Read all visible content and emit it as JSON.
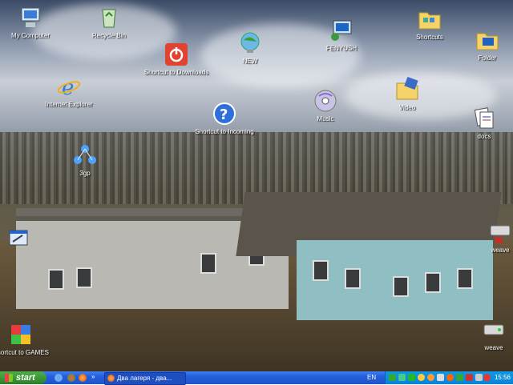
{
  "desktop": {
    "icons": {
      "my_computer": "My Computer",
      "recycle_bin": "Recycle Bin",
      "shortcut_downloads": "Shortcut to Downloads",
      "new": "NEW",
      "fenyushi": "FENYUSH",
      "shortcuts": "Shortcuts",
      "folder_tr": "Folder",
      "internet_explorer": "Internet Explorer",
      "music": "Music",
      "video": "Video",
      "shortcut_incoming": "Shortcut to Incoming",
      "docs": "docs",
      "three_gp": "3gp",
      "left_app": "",
      "weave": "weave",
      "shortcut_games": "Shortcut to GAMES",
      "bottom_right": "weave"
    }
  },
  "taskbar": {
    "start_label": "start",
    "task_label": "Два лагеря - два...",
    "language": "EN",
    "clock": "15:56"
  },
  "colors": {
    "taskbar": "#245edb",
    "start": "#3c9a37",
    "tray": "#0b83d8"
  }
}
